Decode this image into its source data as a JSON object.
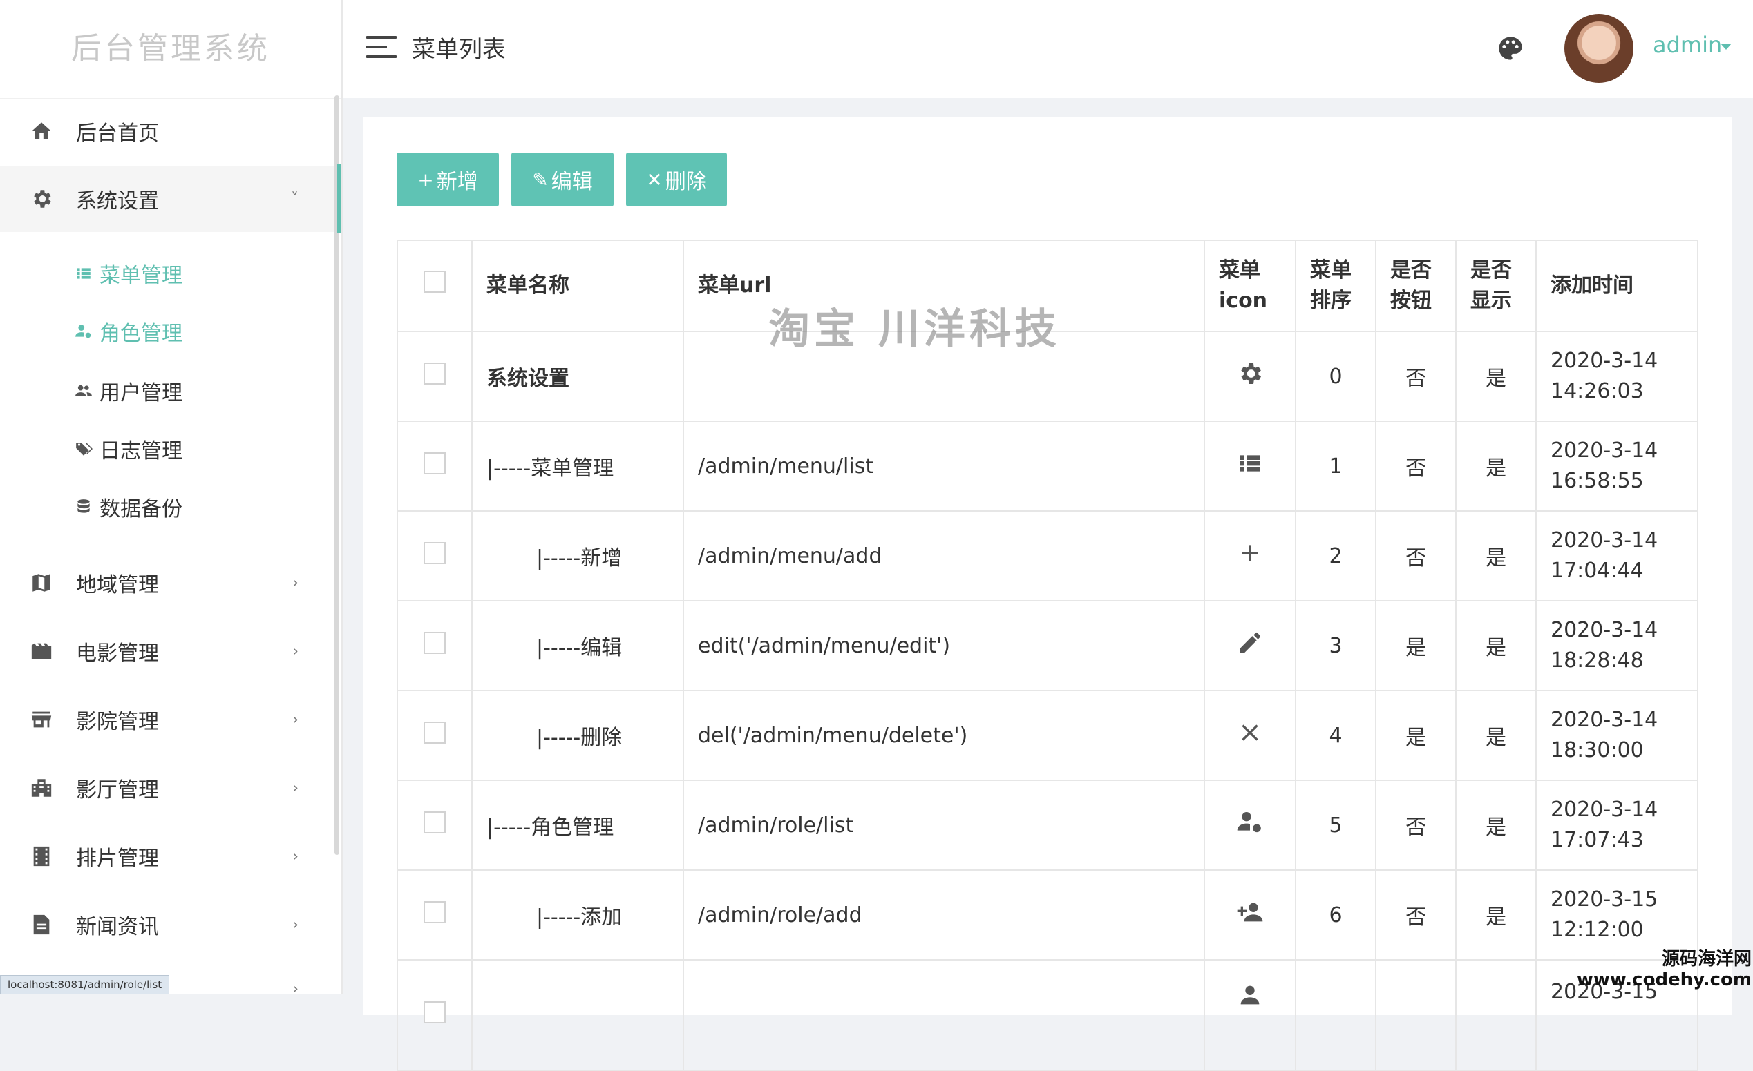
{
  "sidebar": {
    "logo": "后台管理系统",
    "nav": [
      {
        "label": "后台首页",
        "icon": "home-icon"
      },
      {
        "label": "系统设置",
        "icon": "gear-icon",
        "chevron": "˅"
      },
      {
        "label": "地域管理",
        "icon": "map-icon",
        "chevron": "›"
      },
      {
        "label": "电影管理",
        "icon": "clapper-icon",
        "chevron": "›"
      },
      {
        "label": "影院管理",
        "icon": "store-icon",
        "chevron": "›"
      },
      {
        "label": "影厅管理",
        "icon": "building-icon",
        "chevron": "›"
      },
      {
        "label": "排片管理",
        "icon": "film-icon",
        "chevron": "›"
      },
      {
        "label": "新闻资讯",
        "icon": "document-icon",
        "chevron": "›"
      },
      {
        "label": "",
        "icon": "",
        "chevron": "›"
      }
    ],
    "sub": [
      {
        "label": "菜单管理",
        "icon": "list-icon"
      },
      {
        "label": "角色管理",
        "icon": "user-gear-icon"
      },
      {
        "label": "用户管理",
        "icon": "users-icon"
      },
      {
        "label": "日志管理",
        "icon": "tags-icon"
      },
      {
        "label": "数据备份",
        "icon": "database-icon"
      }
    ],
    "status_url": "localhost:8081/admin/role/list"
  },
  "header": {
    "title": "菜单列表",
    "user": "admin"
  },
  "toolbar": {
    "add": "新增",
    "edit": "编辑",
    "delete": "删除"
  },
  "table": {
    "headers": [
      "菜单名称",
      "菜单url",
      "菜单\nicon",
      "菜单\n排序",
      "是否\n按钮",
      "是否\n显示",
      "添加时间"
    ],
    "rows": [
      {
        "name": "系统设置",
        "url": "",
        "icon": "gear-icon",
        "order": "0",
        "button": "否",
        "show": "是",
        "date": "2020-3-14",
        "time": "14:26:03"
      },
      {
        "name": "|-----菜单管理",
        "url": "/admin/menu/list",
        "icon": "list-icon",
        "order": "1",
        "button": "否",
        "show": "是",
        "date": "2020-3-14",
        "time": "16:58:55"
      },
      {
        "name": "|-----新增",
        "url": "/admin/menu/add",
        "icon": "plus-icon",
        "order": "2",
        "button": "否",
        "show": "是",
        "date": "2020-3-14",
        "time": "17:04:44"
      },
      {
        "name": "|-----编辑",
        "url": "edit('/admin/menu/edit')",
        "icon": "pencil-icon",
        "order": "3",
        "button": "是",
        "show": "是",
        "date": "2020-3-14",
        "time": "18:28:48"
      },
      {
        "name": "|-----删除",
        "url": "del('/admin/menu/delete')",
        "icon": "close-icon",
        "order": "4",
        "button": "是",
        "show": "是",
        "date": "2020-3-14",
        "time": "18:30:00"
      },
      {
        "name": "|-----角色管理",
        "url": "/admin/role/list",
        "icon": "user-gear-icon",
        "order": "5",
        "button": "否",
        "show": "是",
        "date": "2020-3-14",
        "time": "17:07:43"
      },
      {
        "name": "|-----添加",
        "url": "/admin/role/add",
        "icon": "user-plus-icon",
        "order": "6",
        "button": "否",
        "show": "是",
        "date": "2020-3-15",
        "time": "12:12:00"
      },
      {
        "name": "",
        "url": "",
        "icon": "user-icon",
        "order": "",
        "button": "",
        "show": "",
        "date": "2020-3-15",
        "time": ""
      }
    ]
  },
  "watermark": "淘宝 川洋科技",
  "corner_mark": {
    "line1": "源码海洋网",
    "line2": "www.codehy.com"
  },
  "colors": {
    "accent": "#5fc3b4",
    "no": "#4a9fd8",
    "yes": "#4caf6a"
  }
}
